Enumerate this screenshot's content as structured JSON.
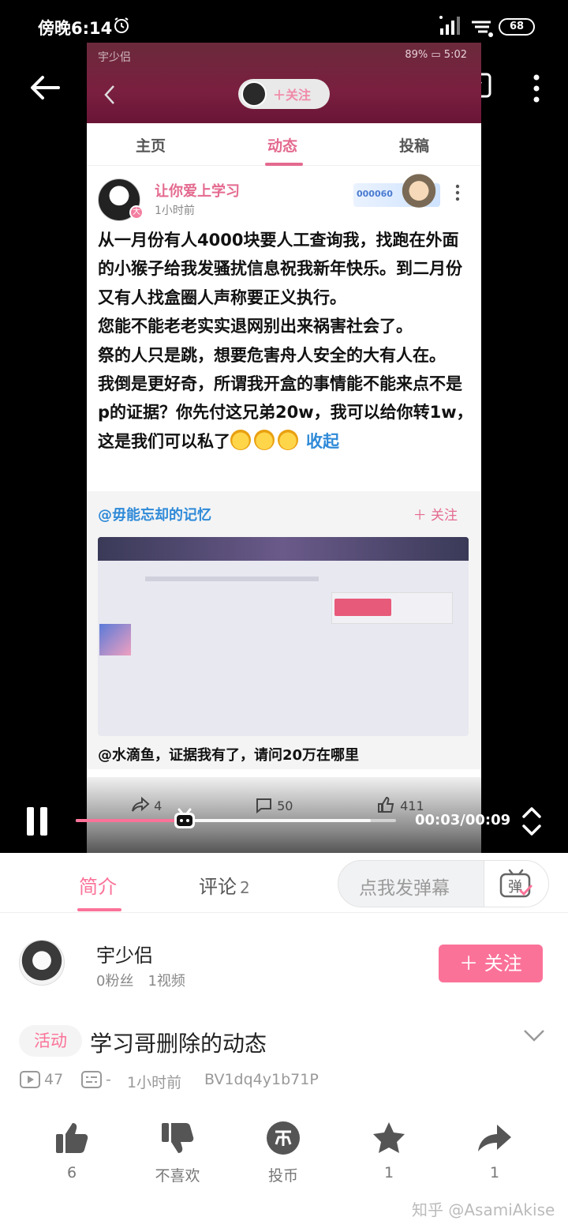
{
  "status_bar": {
    "time": "傍晚6:14",
    "battery": "68"
  },
  "video_frame": {
    "inner_status_left": "宇少侣",
    "inner_status_right": "89% ▭ 5:02",
    "follow_pill": "＋关注",
    "tabs": [
      "主页",
      "动态",
      "投稿"
    ],
    "post": {
      "author": "让你爱上学习",
      "time": "1小时前",
      "badge_number": "000060",
      "body_lines": [
        "从一月份有人4000块要人工查询我，找跑在外面的小猴子给我发骚扰信息祝我新年快乐。到二月份又有人找盒圈人声称要正义执行。",
        "您能不能老老实实退网别出来祸害社会了。",
        "祭的人只是跳，想要危害舟人安全的大有人在。",
        "我倒是更好奇，所谓我开盒的事情能不能来点不是p的证据？你先付这兄弟20w，我可以给你转1w，这是我们可以私了"
      ],
      "collapse_label": "收起",
      "repost": {
        "author": "@毋能忘却的记忆",
        "follow": "＋ 关注",
        "caption": "@水滴鱼，证据我有了，请问20万在哪里"
      },
      "actions": {
        "share": "4",
        "comment": "50",
        "like": "411"
      }
    }
  },
  "player": {
    "time_readout": "00:03/00:09",
    "progress_fraction": 0.34,
    "buffer_fraction": 0.92
  },
  "tabs": {
    "intro": "简介",
    "comment": "评论",
    "comment_count": "2",
    "danmaku_placeholder": "点我发弹幕",
    "danmaku_icon_char": "弹"
  },
  "uploader": {
    "name": "宇少侣",
    "fans": "0粉丝",
    "videos": "1视频",
    "follow_button": "＋ 关注"
  },
  "video_info": {
    "tag": "活动",
    "title": "学习哥删除的动态",
    "views": "47",
    "danmaku": "-",
    "time": "1小时前",
    "bvid": "BV1dq4y1b71P"
  },
  "action_bar": {
    "like": "6",
    "dislike": "不喜欢",
    "coin": "投币",
    "favorite": "1",
    "share": "1"
  },
  "watermark": "知乎 @AsamiAkise",
  "colors": {
    "accent": "#fb7299",
    "link": "#2f8ad8"
  }
}
